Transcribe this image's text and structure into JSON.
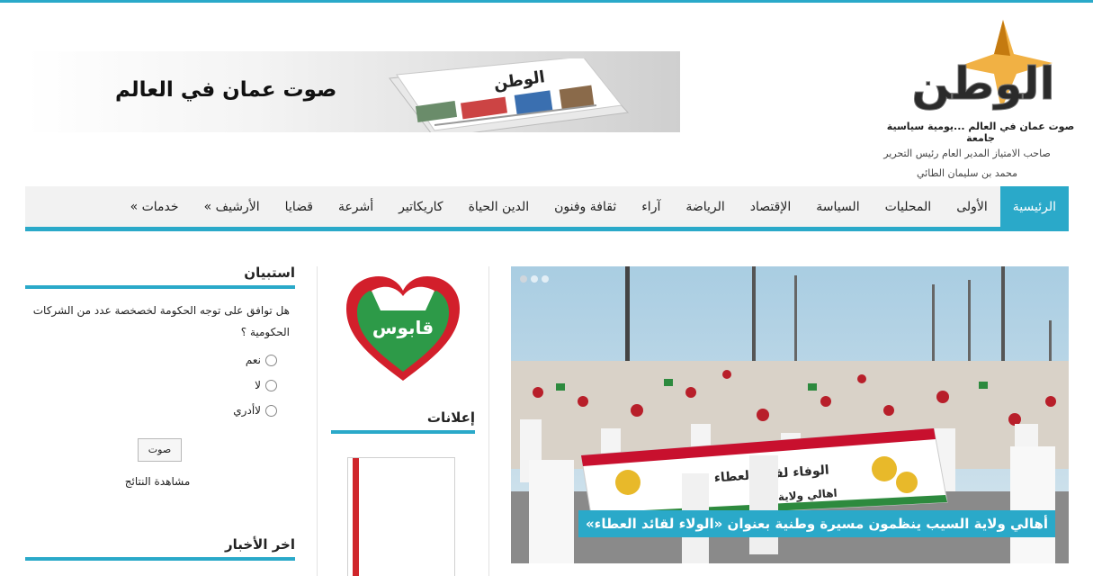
{
  "header": {
    "logo_text": "الوطن",
    "tagline": "صوت عمان في العالم ...يومية سياسية جامعة",
    "owner_title": "صاحب الامتياز المدير العام رئيس التحرير",
    "owner_name": "محمد بن سليمان الطائي"
  },
  "banner": {
    "slogan": "صوت عمان في العالم",
    "paper_masthead": "الوطن"
  },
  "nav": {
    "items": [
      {
        "label": "الرئيسية",
        "active": true
      },
      {
        "label": "الأولى"
      },
      {
        "label": "المحليات"
      },
      {
        "label": "السياسة"
      },
      {
        "label": "الإقتصاد"
      },
      {
        "label": "الرياضة"
      },
      {
        "label": "آراء"
      },
      {
        "label": "ثقافة وفنون"
      },
      {
        "label": "الدين الحياة"
      },
      {
        "label": "كاريكاتير"
      },
      {
        "label": "أشرعة"
      },
      {
        "label": "قضايا"
      },
      {
        "label": "الأرشيف »"
      },
      {
        "label": "خدمات »"
      }
    ]
  },
  "slider": {
    "caption": "أهالي ولاية السيب ينظمون مسيرة وطنية بعنوان «الولاء لقائد العطاء»",
    "banner_text_1": "الوفاء لقائد العطاء",
    "banner_text_2": "اهالي ولاية"
  },
  "ads": {
    "title": "إعلانات",
    "heart_text": "قابوس"
  },
  "poll": {
    "title": "استبيان",
    "question": "هل توافق على توجه الحكومة لخصخصة عدد من الشركات الحكومية ؟",
    "options": [
      "نعم",
      "لا",
      "لاأدري"
    ],
    "vote_label": "صوت",
    "results_label": "مشاهدة النتائج"
  },
  "latest": {
    "title": "اخر الأخبار"
  },
  "colors": {
    "accent": "#2aa9c9",
    "ad_strip": "#d0262b"
  }
}
